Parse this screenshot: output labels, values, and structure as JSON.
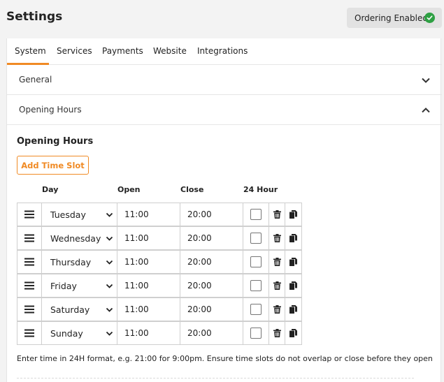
{
  "header": {
    "title": "Settings",
    "status_label": "Ordering Enabled",
    "status_color": "#2ea043"
  },
  "tabs": [
    {
      "label": "System",
      "active": true
    },
    {
      "label": "Services",
      "active": false
    },
    {
      "label": "Payments",
      "active": false
    },
    {
      "label": "Website",
      "active": false
    },
    {
      "label": "Integrations",
      "active": false
    }
  ],
  "accordions": [
    {
      "label": "General",
      "expanded": false
    },
    {
      "label": "Opening Hours",
      "expanded": true
    }
  ],
  "opening_hours": {
    "title": "Opening Hours",
    "add_button": "Add Time Slot",
    "columns": {
      "day": "Day",
      "open": "Open",
      "close": "Close",
      "h24": "24 Hour"
    },
    "rows": [
      {
        "day": "Tuesday",
        "open": "11:00",
        "close": "20:00",
        "h24": false
      },
      {
        "day": "Wednesday",
        "open": "11:00",
        "close": "20:00",
        "h24": false
      },
      {
        "day": "Thursday",
        "open": "11:00",
        "close": "20:00",
        "h24": false
      },
      {
        "day": "Friday",
        "open": "11:00",
        "close": "20:00",
        "h24": false
      },
      {
        "day": "Saturday",
        "open": "11:00",
        "close": "20:00",
        "h24": false
      },
      {
        "day": "Sunday",
        "open": "11:00",
        "close": "20:00",
        "h24": false
      }
    ],
    "hint": "Enter time in 24H format, e.g. 21:00 for 9:00pm. Ensure time slots do not overlap or close before they open"
  },
  "colors": {
    "accent": "#f08a24"
  },
  "icons": {
    "drag": "drag-handle-icon",
    "delete": "trash-icon",
    "copy": "copy-icon",
    "status": "check-circle-icon",
    "expand": "chevron-down-icon",
    "collapse": "chevron-up-icon"
  }
}
